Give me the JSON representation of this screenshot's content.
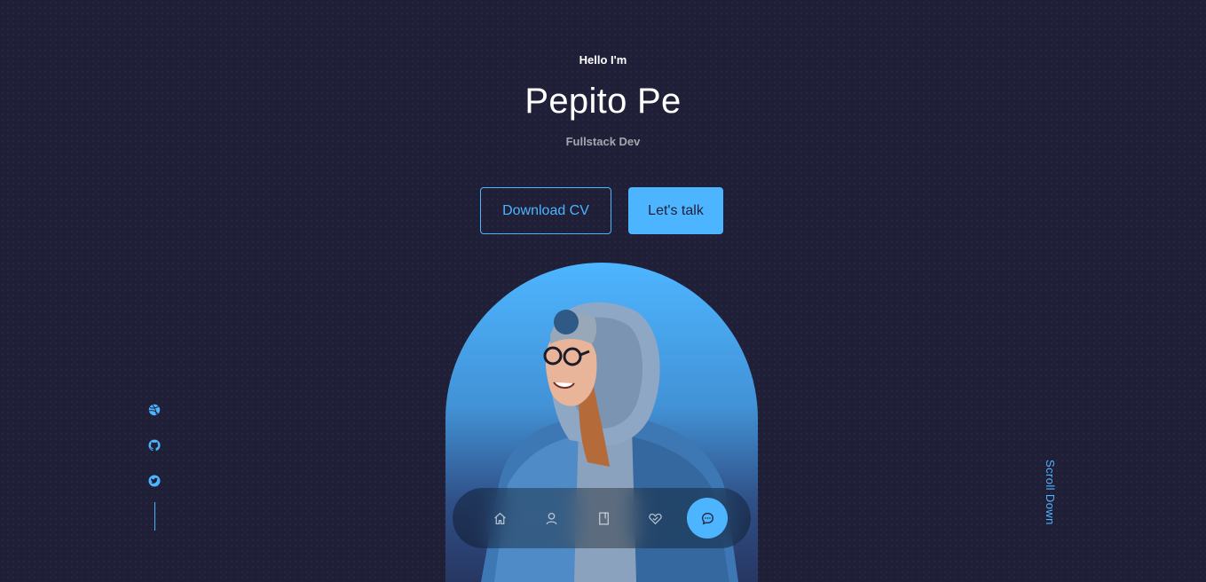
{
  "header": {
    "greeting": "Hello I'm",
    "name": "Pepito Pe",
    "role": "Fullstack Dev"
  },
  "cta": {
    "download_label": "Download CV",
    "talk_label": "Let's talk"
  },
  "socials": {
    "items": [
      {
        "name": "dribbble-icon"
      },
      {
        "name": "github-icon"
      },
      {
        "name": "twitter-icon"
      }
    ]
  },
  "scroll": {
    "label": "Scroll Down"
  },
  "nav": {
    "items": [
      {
        "icon": "home-icon",
        "active": false
      },
      {
        "icon": "user-icon",
        "active": false
      },
      {
        "icon": "book-icon",
        "active": false
      },
      {
        "icon": "services-icon",
        "active": false
      },
      {
        "icon": "message-icon",
        "active": true
      }
    ]
  },
  "colors": {
    "background": "#1f1f38",
    "accent": "#4db5ff",
    "text": "#ffffff",
    "muted_text": "rgba(255,255,255,0.6)"
  }
}
